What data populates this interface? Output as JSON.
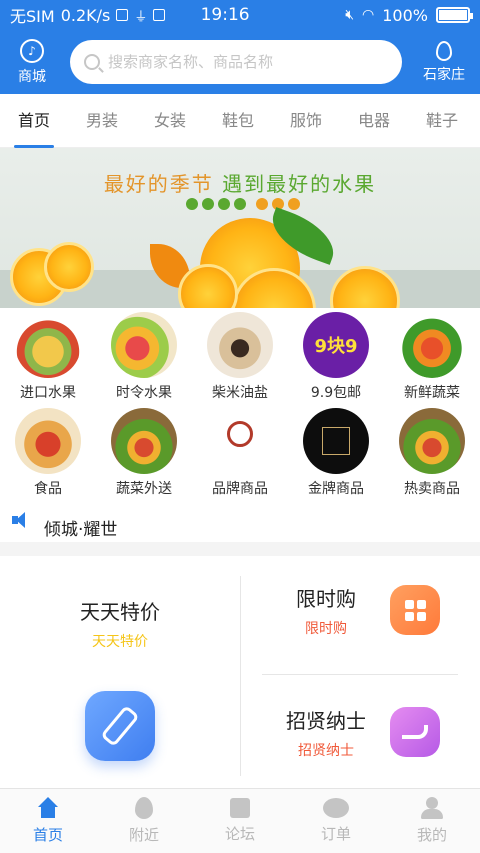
{
  "status_bar": {
    "carrier": "无SIM",
    "speed": "0.2K/s",
    "time": "19:16",
    "battery": "100%"
  },
  "header": {
    "left_label": "商城",
    "search_placeholder": "搜索商家名称、商品名称",
    "right_label": "石家庄"
  },
  "tabs": [
    {
      "label": "首页",
      "active": true
    },
    {
      "label": "男装"
    },
    {
      "label": "女装"
    },
    {
      "label": "鞋包"
    },
    {
      "label": "服饰"
    },
    {
      "label": "电器"
    },
    {
      "label": "鞋子"
    }
  ],
  "banner": {
    "title_orange": "最好的季节",
    "title_green": "遇到最好的水果"
  },
  "categories": [
    {
      "label": "进口水果",
      "icon": "pineapple-fruit-icon"
    },
    {
      "label": "时令水果",
      "icon": "seasonal-fruit-icon"
    },
    {
      "label": "柴米油盐",
      "icon": "grocery-icon"
    },
    {
      "label": "9.9包邮",
      "icon": "nine-nine-badge-icon",
      "badge_text": "9块9"
    },
    {
      "label": "新鲜蔬菜",
      "icon": "vegetables-icon"
    },
    {
      "label": "食品",
      "icon": "snacks-icon"
    },
    {
      "label": "蔬菜外送",
      "icon": "veg-delivery-icon"
    },
    {
      "label": "品牌商品",
      "icon": "brand-logo-icon"
    },
    {
      "label": "金牌商品",
      "icon": "gold-brand-icon"
    },
    {
      "label": "热卖商品",
      "icon": "hot-sale-icon"
    }
  ],
  "notice": {
    "text": "倾城·耀世"
  },
  "promo": {
    "left": {
      "title": "天天特价",
      "subtitle": "天天特价",
      "subtitle_color": "#f5c518"
    },
    "right_top": {
      "title": "限时购",
      "subtitle": "限时购",
      "subtitle_color": "#f05a3a"
    },
    "right_bottom": {
      "title": "招贤纳士",
      "subtitle": "招贤纳士",
      "subtitle_color": "#f05a3a"
    }
  },
  "tabbar": [
    {
      "label": "首页",
      "icon": "home-icon",
      "active": true
    },
    {
      "label": "附近",
      "icon": "location-pin-icon"
    },
    {
      "label": "论坛",
      "icon": "forum-bag-icon"
    },
    {
      "label": "订单",
      "icon": "chat-bubbles-icon"
    },
    {
      "label": "我的",
      "icon": "user-icon"
    }
  ],
  "colors": {
    "primary": "#2a7fe6",
    "accent_orange": "#f08a10",
    "accent_green": "#5aa830"
  }
}
